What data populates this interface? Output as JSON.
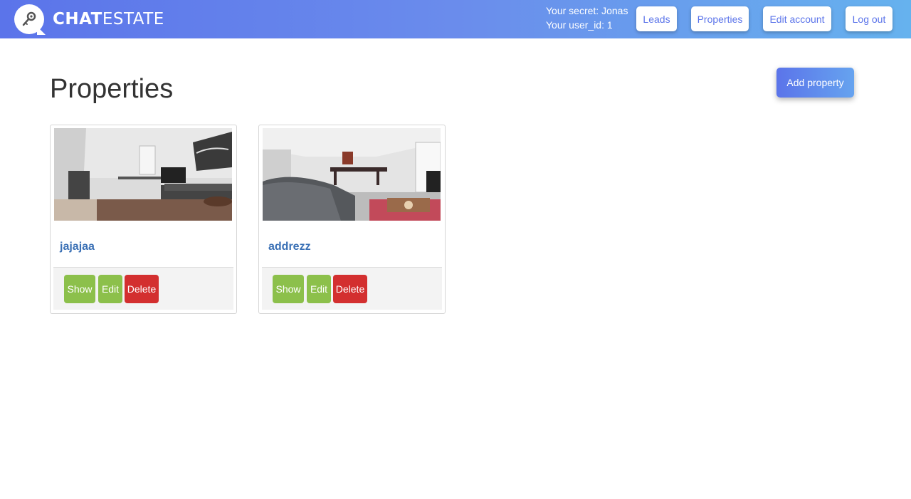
{
  "brand": {
    "name_bold": "CHAT",
    "name_light": "ESTATE",
    "logo_icon": "key-icon"
  },
  "user": {
    "secret_line": "Your secret: Jonas",
    "id_line": "Your user_id: 1"
  },
  "nav": {
    "leads": "Leads",
    "properties": "Properties",
    "edit_account": "Edit account",
    "logout": "Log out"
  },
  "page": {
    "title": "Properties",
    "add_button": "Add property"
  },
  "properties": [
    {
      "name": "jajajaa",
      "show": "Show",
      "edit": "Edit",
      "delete": "Delete"
    },
    {
      "name": "addrezz",
      "show": "Show",
      "edit": "Edit",
      "delete": "Delete"
    }
  ],
  "colors": {
    "accent": "#5b74ea",
    "accent_end": "#66b2ee",
    "action_green": "#8cc04b",
    "danger_red": "#d32f2f",
    "link": "#3a70b5"
  }
}
